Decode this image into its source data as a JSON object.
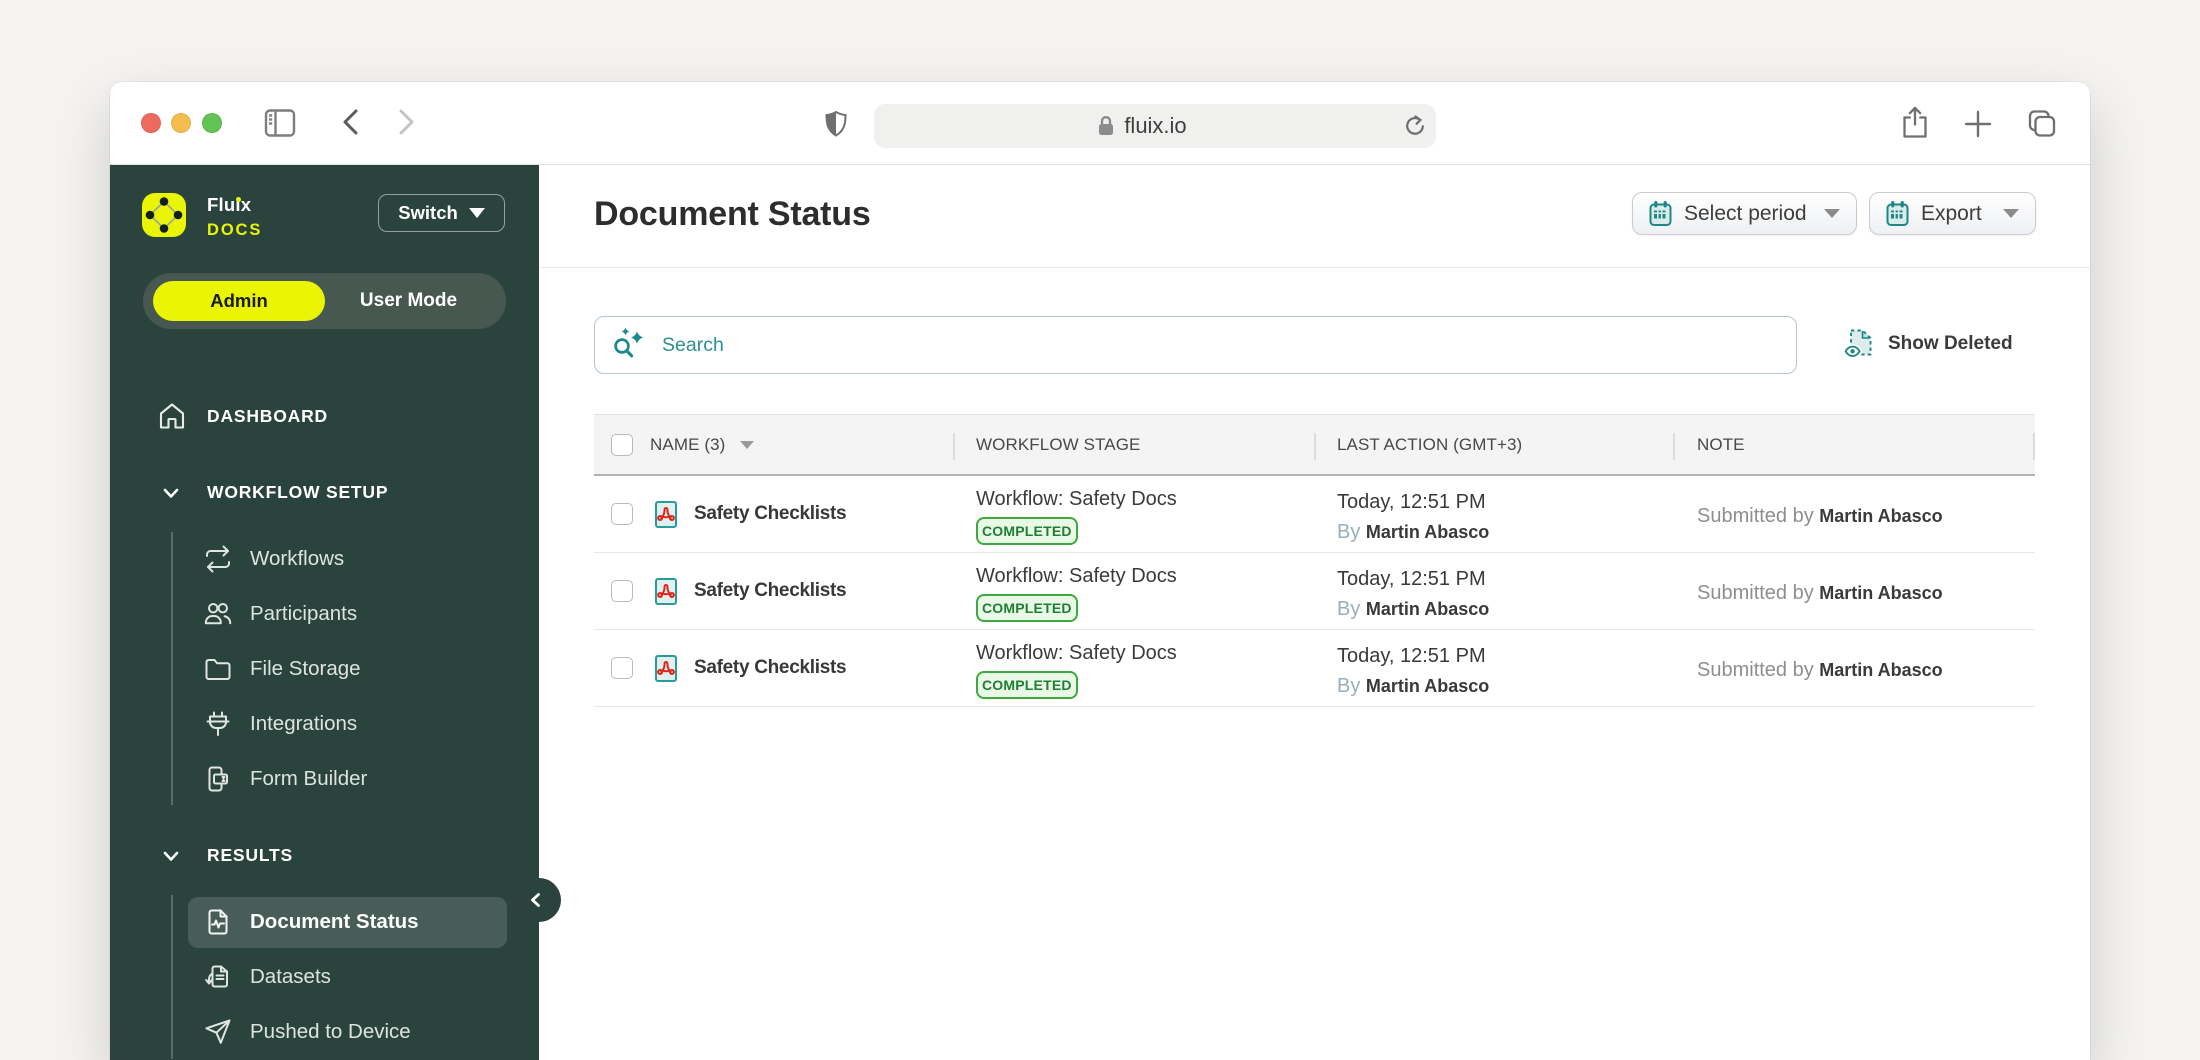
{
  "browser": {
    "url": "fluix.io"
  },
  "sidebar": {
    "brand_parts": [
      "Flu",
      "i",
      "x"
    ],
    "product": "DOCS",
    "switch_label": "Switch",
    "mode": {
      "admin": "Admin",
      "user": "User Mode"
    },
    "dashboard": "DASHBOARD",
    "workflow_setup": "WORKFLOW SETUP",
    "workflow_items": [
      "Workflows",
      "Participants",
      "File Storage",
      "Integrations",
      "Form Builder"
    ],
    "results": "RESULTS",
    "results_items": [
      "Document Status",
      "Datasets",
      "Pushed to Device"
    ]
  },
  "main": {
    "title": "Document Status",
    "select_period_label": "Select period",
    "export_label": "Export",
    "search_placeholder": "Search",
    "show_deleted_label": "Show Deleted",
    "table": {
      "columns": {
        "name": "NAME (3)",
        "stage": "WORKFLOW STAGE",
        "last_action": "LAST ACTION (GMT+3)",
        "note": "NOTE"
      },
      "rows": [
        {
          "name": "Safety Checklists",
          "stage": "Workflow: Safety Docs",
          "status": "COMPLETED",
          "time": "Today, 12:51 PM",
          "by_prefix": "By",
          "by_name": "Martin Abasco",
          "note_prefix": "Submitted by",
          "note_name": "Martin Abasco"
        },
        {
          "name": "Safety Checklists",
          "stage": "Workflow: Safety Docs",
          "status": "COMPLETED",
          "time": "Today, 12:51 PM",
          "by_prefix": "By",
          "by_name": "Martin Abasco",
          "note_prefix": "Submitted by",
          "note_name": "Martin Abasco"
        },
        {
          "name": "Safety Checklists",
          "stage": "Workflow: Safety Docs",
          "status": "COMPLETED",
          "time": "Today, 12:51 PM",
          "by_prefix": "By",
          "by_name": "Martin Abasco",
          "note_prefix": "Submitted by",
          "note_name": "Martin Abasco"
        }
      ]
    }
  },
  "colors": {
    "accent_yellow": "#e9f505",
    "teal": "#1d8788",
    "sidebar_green": "#2b433d",
    "badge_green": "#35a341",
    "pdf_red": "#e2231a"
  }
}
